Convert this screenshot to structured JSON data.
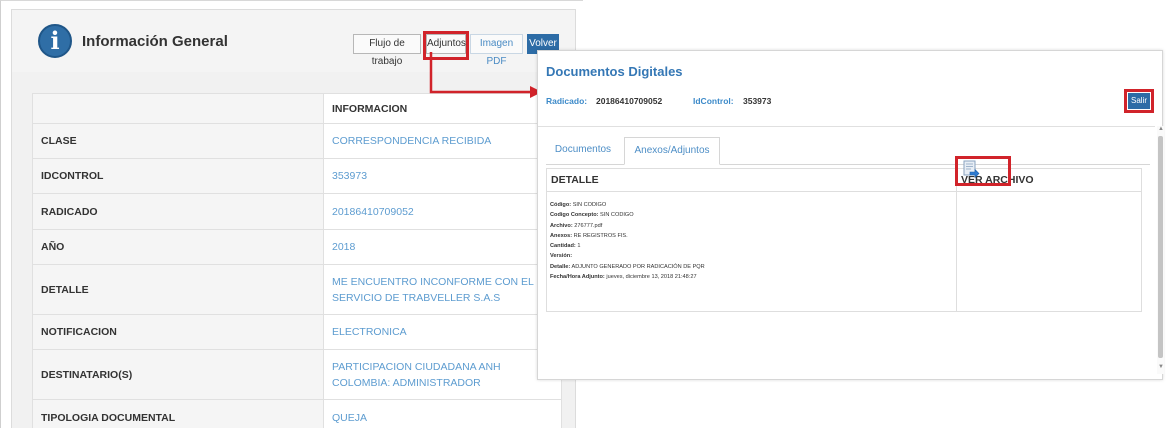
{
  "general": {
    "title": "Información General",
    "buttons": {
      "flujo": "Flujo de trabajo",
      "adjuntos": "Adjuntos",
      "pdf": "Imagen PDF",
      "volver": "Volver"
    },
    "table_header": "INFORMACION",
    "rows": [
      {
        "label": "CLASE",
        "value": "CORRESPONDENCIA RECIBIDA"
      },
      {
        "label": "IDCONTROL",
        "value": "353973"
      },
      {
        "label": "RADICADO",
        "value": "20186410709052"
      },
      {
        "label": "AÑO",
        "value": "2018"
      },
      {
        "label": "DETALLE",
        "value": "ME ENCUENTRO INCONFORME CON EL SERVICIO DE TRABVELLER S.A.S"
      },
      {
        "label": "NOTIFICACION",
        "value": "ELECTRONICA"
      },
      {
        "label": "DESTINATARIO(S)",
        "value": "PARTICIPACION CIUDADANA ANH COLOMBIA: ADMINISTRADOR"
      },
      {
        "label": "TIPOLOGIA DOCUMENTAL",
        "value": "QUEJA"
      }
    ]
  },
  "documentos": {
    "title": "Documentos Digitales",
    "radicado_label": "Radicado:",
    "radicado_value": "20186410709052",
    "idcontrol_label": "IdControl:",
    "idcontrol_value": "353973",
    "salir": "Salir",
    "tabs": [
      "Documentos",
      "Anexos/Adjuntos"
    ],
    "col_detalle": "DETALLE",
    "col_ver": "VER ARCHIVO",
    "detail": [
      {
        "label": "Código:",
        "value": "SIN CODIGO"
      },
      {
        "label": "Codigo Concepto:",
        "value": "SIN CODIGO"
      },
      {
        "label": "Archivo:",
        "value": "276777.pdf"
      },
      {
        "label": "Anexos:",
        "value": "RE REGISTROS FIS."
      },
      {
        "label": "Cantidad:",
        "value": "1"
      },
      {
        "label": "Versión:",
        "value": ""
      },
      {
        "label": "Detalle:",
        "value": "ADJUNTO GENERADO POR RADICACIÓN DE PQR"
      },
      {
        "label": "Fecha/Hora Adjunto:",
        "value": "jueves, diciembre 13, 2018 21:48:27"
      }
    ],
    "file_icon": "document-download-icon"
  },
  "colors": {
    "accent": "#2d6ca6",
    "link": "#5d9cd0",
    "highlight": "#d1232a"
  }
}
